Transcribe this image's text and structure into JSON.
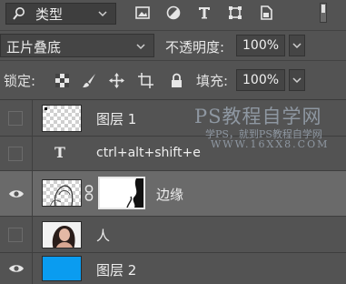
{
  "filter": {
    "kind_label": "类型"
  },
  "blend": {
    "mode": "正片叠底",
    "opacity_label": "不透明度:",
    "opacity_value": "100%"
  },
  "lock": {
    "label": "锁定:",
    "fill_label": "填充:",
    "fill_value": "100%"
  },
  "layers": [
    {
      "name": "图层 1",
      "visible": false,
      "thumb": "transparent"
    },
    {
      "name": "ctrl+alt+shift+e",
      "visible": false,
      "thumb": "text"
    },
    {
      "name": "边缘",
      "visible": true,
      "thumb": "portrait-with-mask",
      "selected": true
    },
    {
      "name": "人",
      "visible": false,
      "thumb": "portrait"
    },
    {
      "name": "图层 2",
      "visible": true,
      "thumb": "fill",
      "fill_color": "#0a9cf0"
    }
  ],
  "watermark": {
    "line1": "PS教程自学网",
    "line2": "学PS，就到PS教程自学网",
    "line3": "WWW.16XX8.COM"
  },
  "colors": {
    "panel_bg": "#535353",
    "selected_row": "#6a6a6a",
    "layer2_fill": "#0a9cf0"
  }
}
